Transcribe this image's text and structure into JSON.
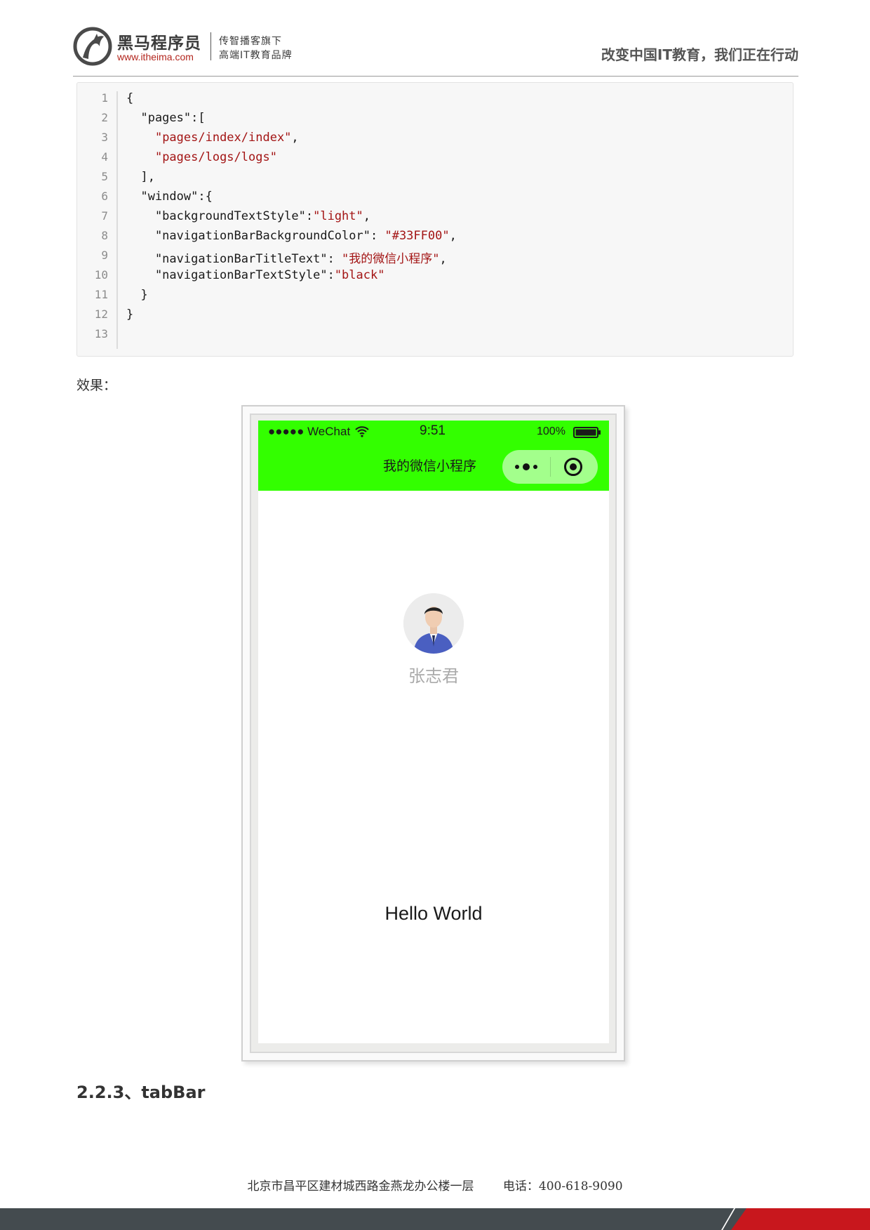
{
  "header": {
    "brand_name": "黑马程序员",
    "brand_url": "www.itheima.com",
    "tagline_1": "传智播客旗下",
    "tagline_2": "高端IT教育品牌",
    "slogan": "改变中国IT教育，我们正在行动"
  },
  "code": {
    "line_numbers": [
      "1",
      "2",
      "3",
      "4",
      "5",
      "6",
      "7",
      "8",
      "9",
      "10",
      "11",
      "12",
      "13"
    ],
    "lines": [
      {
        "pre": "{",
        "str": "",
        "post": ""
      },
      {
        "pre": "  \"pages\":[",
        "str": "",
        "post": ""
      },
      {
        "pre": "    ",
        "str": "\"pages/index/index\"",
        "post": ","
      },
      {
        "pre": "    ",
        "str": "\"pages/logs/logs\"",
        "post": ""
      },
      {
        "pre": "  ],",
        "str": "",
        "post": ""
      },
      {
        "pre": "  \"window\":{",
        "str": "",
        "post": ""
      },
      {
        "pre": "    \"backgroundTextStyle\":",
        "str": "\"light\"",
        "post": ","
      },
      {
        "pre": "    \"navigationBarBackgroundColor\": ",
        "str": "\"#33FF00\"",
        "post": ","
      },
      {
        "pre": "    \"navigationBarTitleText\": ",
        "str": "\"我的微信小程序\"",
        "post": ","
      },
      {
        "pre": "    \"navigationBarTextStyle\":",
        "str": "\"black\"",
        "post": ""
      },
      {
        "pre": "  }",
        "str": "",
        "post": ""
      },
      {
        "pre": "}",
        "str": "",
        "post": ""
      },
      {
        "pre": "",
        "str": "",
        "post": ""
      }
    ]
  },
  "effect_label": "效果：",
  "phone": {
    "carrier": "●●●●● WeChat",
    "time": "9:51",
    "battery": "100%",
    "nav_title": "我的微信小程序",
    "nav_color": "#33FF00",
    "username": "张志君",
    "hello": "Hello World",
    "icons": [
      "wifi-icon",
      "battery-icon",
      "more-icon",
      "target-icon",
      "avatar-photo"
    ]
  },
  "section_heading": "2.2.3、tabBar",
  "footer": {
    "address": "北京市昌平区建材城西路金燕龙办公楼一层",
    "phone": "电话：400-618-9090"
  },
  "colors": {
    "string": "#a31515",
    "footer_dark": "#444b4f",
    "footer_red": "#c8171d",
    "brand_red": "#b3261e"
  }
}
